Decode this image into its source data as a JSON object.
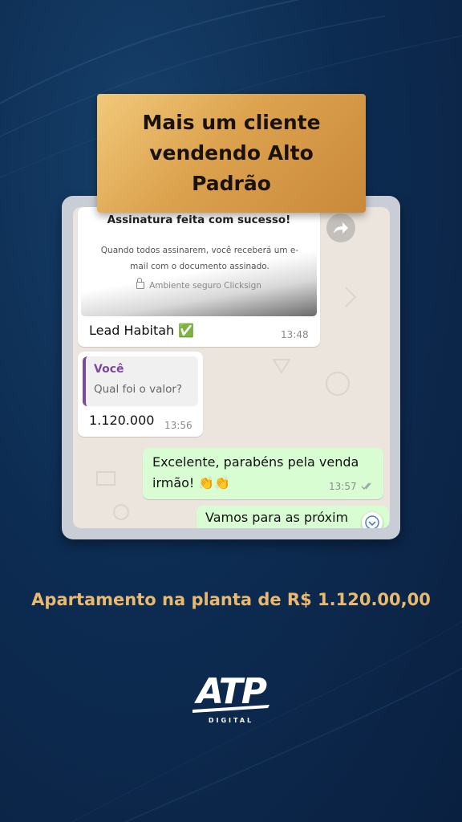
{
  "headline": "Mais um cliente vendendo Alto Padrão",
  "chat": {
    "link_preview": {
      "title": "Assinatura feita com sucesso!",
      "body": "Quando todos assinarem, você receberá um e-mail com o documento assinado.",
      "secure_label": "Ambiente seguro Clicksign"
    },
    "messages": [
      {
        "direction": "incoming",
        "text": "Lead Habitah ✅",
        "time": "13:48"
      },
      {
        "direction": "incoming",
        "quote_author": "Você",
        "quote_text": "Qual foi o valor?",
        "text": "1.120.000",
        "time": "13:56"
      },
      {
        "direction": "outgoing",
        "text_line1": "Excelente, parabéns pela venda",
        "text_line2": "irmão! 👏👏",
        "time": "13:57",
        "status": "read"
      },
      {
        "direction": "outgoing",
        "text": "Vamos para as próxim"
      }
    ]
  },
  "caption": "Apartamento na planta de R$ 1.120.00,00",
  "logo": {
    "main": "ATP",
    "sub": "DIGITAL"
  },
  "colors": {
    "gold": "#dca24e",
    "caption": "#e9b96e",
    "background": "#0d2c52",
    "outgoing_bubble": "#d9fdd3",
    "quote_accent": "#7b4a9d"
  }
}
